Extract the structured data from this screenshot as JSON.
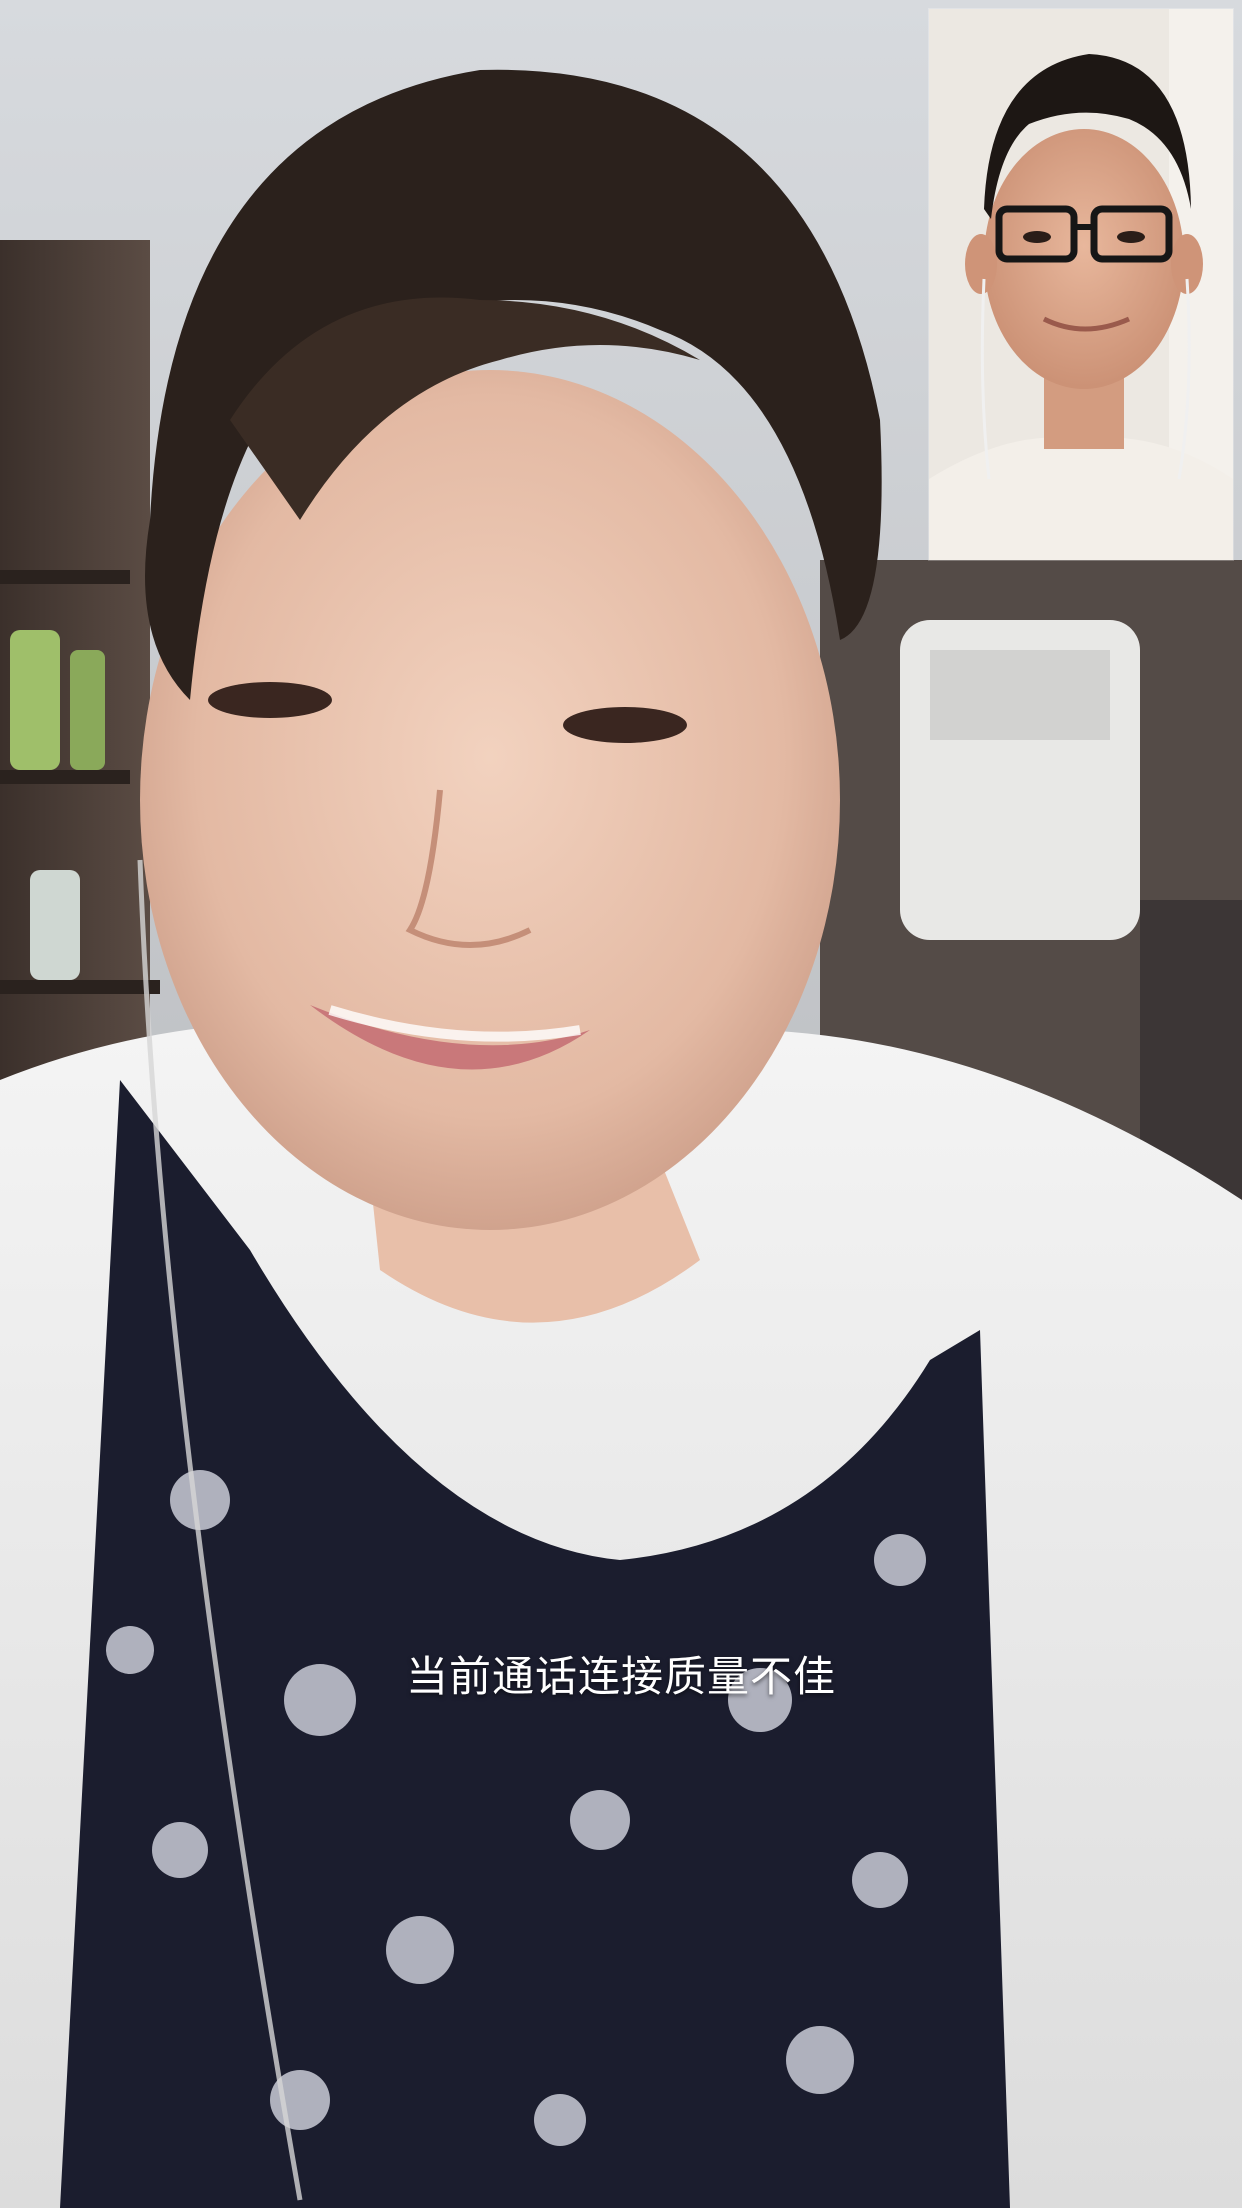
{
  "call": {
    "status_message": "当前通话连接质量不佳"
  },
  "remote_video": {
    "description_icon": "remote-participant-video"
  },
  "local_preview": {
    "description_icon": "self-camera-preview"
  },
  "colors": {
    "toast_text": "#ffffff"
  }
}
